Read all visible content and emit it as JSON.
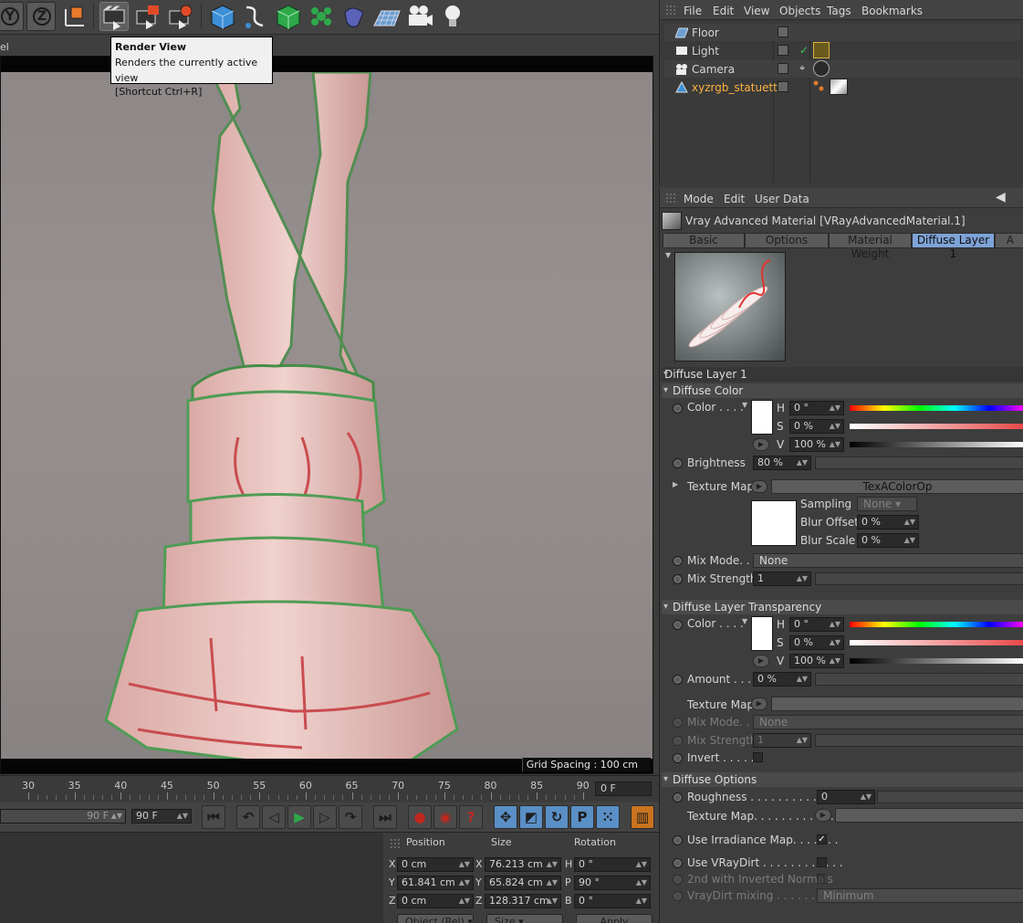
{
  "viewport": {
    "label": "el",
    "grid_spacing": "Grid Spacing : 100 cm"
  },
  "tooltip": {
    "title": "Render View",
    "desc": "Renders the currently active view",
    "shortcut": "[Shortcut Ctrl+R]"
  },
  "toolbar": {
    "axis_y": "Y",
    "axis_z": "Z"
  },
  "timeline": {
    "ticks": [
      "30",
      "35",
      "40",
      "45",
      "50",
      "55",
      "60",
      "65",
      "70",
      "75",
      "80",
      "85",
      "90"
    ],
    "current_frame": "0 F",
    "end_frame_a": "90 F",
    "end_frame_b": "90 F"
  },
  "coords": {
    "headers": {
      "position": "Position",
      "size": "Size",
      "rotation": "Rotation"
    },
    "rows": [
      {
        "axis": "X",
        "pos": "0 cm",
        "size_axis": "X",
        "size": "76.213 cm",
        "rot_axis": "H",
        "rot": "0 °"
      },
      {
        "axis": "Y",
        "pos": "61.841 cm",
        "size_axis": "Y",
        "size": "65.824 cm",
        "rot_axis": "P",
        "rot": "90 °"
      },
      {
        "axis": "Z",
        "pos": "0 cm",
        "size_axis": "Z",
        "size": "128.317 cm",
        "rot_axis": "B",
        "rot": "0 °"
      }
    ],
    "mode_dropdown": "Object (Rel)",
    "size_dropdown": "Size",
    "apply": "Apply"
  },
  "object_manager": {
    "menu": [
      "File",
      "Edit",
      "View",
      "Objects",
      "Tags",
      "Bookmarks"
    ],
    "objects": [
      {
        "name": "Floor"
      },
      {
        "name": "Light"
      },
      {
        "name": "Camera"
      },
      {
        "name": "xyzrgb_statuette"
      }
    ],
    "selected_color": "#ffb23d"
  },
  "attributes": {
    "menu": [
      "Mode",
      "Edit",
      "User Data"
    ],
    "material_title": "Vray Advanced Material [VRayAdvancedMaterial.1]",
    "tabs": [
      "Basic",
      "Options",
      "Material Weight",
      "Diffuse Layer 1",
      "A"
    ],
    "layer_title": "Diffuse Layer 1",
    "diffuse_color": {
      "section": "Diffuse Color",
      "color_label": "Color . . . .",
      "h_label": "H",
      "h": "0 °",
      "s_label": "S",
      "s": "0 %",
      "v_label": "V",
      "v": "100 %",
      "brightness_label": "Brightness",
      "brightness": "80 %",
      "texture_map_label": "Texture Map",
      "texture_map": "TexAColorOp",
      "sampling_label": "Sampling",
      "sampling": "None",
      "blur_offset_label": "Blur Offset",
      "blur_offset": "0 %",
      "blur_scale_label": "Blur Scale",
      "blur_scale": "0 %",
      "mix_mode_label": "Mix Mode. . .",
      "mix_mode": "None",
      "mix_strength_label": "Mix Strength",
      "mix_strength": "1"
    },
    "transparency": {
      "section": "Diffuse Layer Transparency",
      "color_label": "Color . . . .",
      "h_label": "H",
      "h": "0 °",
      "s_label": "S",
      "s": "0 %",
      "v_label": "V",
      "v": "100 %",
      "amount_label": "Amount . . . .",
      "amount": "0 %",
      "texture_map_label": "Texture Map",
      "mix_mode_label": "Mix Mode. . .",
      "mix_mode": "None",
      "mix_strength_label": "Mix Strength",
      "mix_strength": "1",
      "invert_label": "Invert . . . . . ."
    },
    "options": {
      "section": "Diffuse Options",
      "roughness_label": "Roughness . . . . . . . . . . . . .",
      "roughness": "0",
      "texture_map_label": "Texture Map. . . . . . . . . . . .",
      "irradiance_label": "Use Irradiance Map. . . . . . .",
      "vraydirt_label": "Use VRayDirt . . . . . . . . . . . .",
      "inverted_label": "2nd with Inverted Normals",
      "mixing_label": "VrayDirt mixing . . . . . . . . . .",
      "mixing": "Minimum"
    }
  }
}
